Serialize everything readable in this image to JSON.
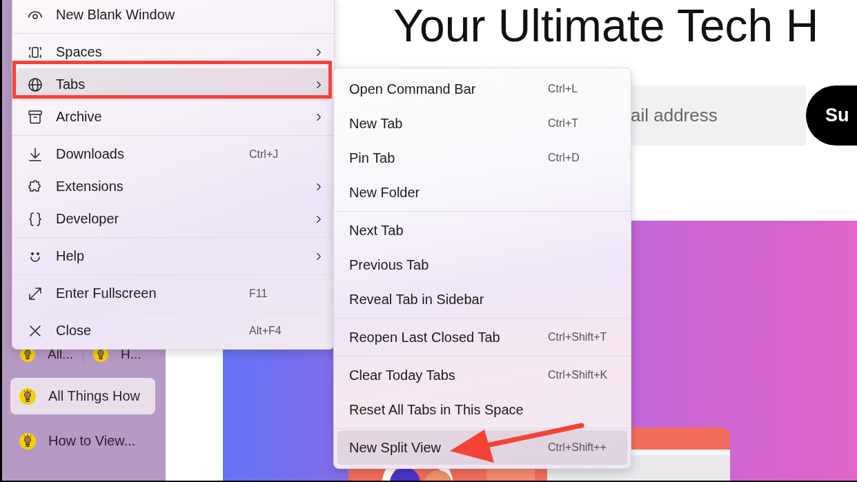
{
  "sidebar": {
    "pinned_tabs": [
      {
        "label": "All..."
      },
      {
        "label": "H..."
      }
    ],
    "tabs": [
      {
        "label": "All Things How",
        "selected": true
      },
      {
        "label": "How to View...",
        "selected": false
      }
    ]
  },
  "page": {
    "heading": "Your Ultimate Tech H",
    "email_field": {
      "placeholder": "ail address"
    },
    "subscribe_button": "Su"
  },
  "menu": {
    "sections": [
      {
        "items": [
          {
            "label": "New Blank Window",
            "submenu": false,
            "selected": false
          }
        ]
      },
      {
        "items": [
          {
            "label": "Spaces",
            "submenu": true,
            "selected": false
          },
          {
            "label": "Tabs",
            "submenu": true,
            "selected": true
          },
          {
            "label": "Archive",
            "submenu": true,
            "selected": false
          }
        ]
      },
      {
        "items": [
          {
            "label": "Downloads",
            "shortcut": "Ctrl+J",
            "submenu": false,
            "selected": false
          },
          {
            "label": "Extensions",
            "submenu": true,
            "selected": false
          },
          {
            "label": "Developer",
            "submenu": true,
            "selected": false
          }
        ]
      },
      {
        "items": [
          {
            "label": "Help",
            "submenu": true,
            "selected": false
          }
        ]
      },
      {
        "items": [
          {
            "label": "Enter Fullscreen",
            "shortcut": "F11",
            "submenu": false,
            "selected": false
          }
        ]
      },
      {
        "items": [
          {
            "label": "Close",
            "shortcut": "Alt+F4",
            "submenu": false,
            "selected": false
          }
        ]
      }
    ]
  },
  "submenu": {
    "sections": [
      {
        "items": [
          {
            "label": "Open Command Bar",
            "shortcut": "Ctrl+L",
            "selected": false
          },
          {
            "label": "New Tab",
            "shortcut": "Ctrl+T",
            "selected": false
          },
          {
            "label": "Pin Tab",
            "shortcut": "Ctrl+D",
            "selected": false
          },
          {
            "label": "New Folder",
            "selected": false
          }
        ]
      },
      {
        "items": [
          {
            "label": "Next Tab",
            "selected": false
          },
          {
            "label": "Previous Tab",
            "selected": false
          },
          {
            "label": "Reveal Tab in Sidebar",
            "selected": false
          }
        ]
      },
      {
        "items": [
          {
            "label": "Reopen Last Closed Tab",
            "shortcut": "Ctrl+Shift+T",
            "selected": false
          }
        ]
      },
      {
        "items": [
          {
            "label": "Clear Today Tabs",
            "shortcut": "Ctrl+Shift+K",
            "selected": false
          },
          {
            "label": "Reset All Tabs in This Space",
            "selected": false
          }
        ]
      },
      {
        "items": [
          {
            "label": "New Split View",
            "shortcut": "Ctrl+Shift++",
            "selected": true
          }
        ]
      }
    ]
  }
}
